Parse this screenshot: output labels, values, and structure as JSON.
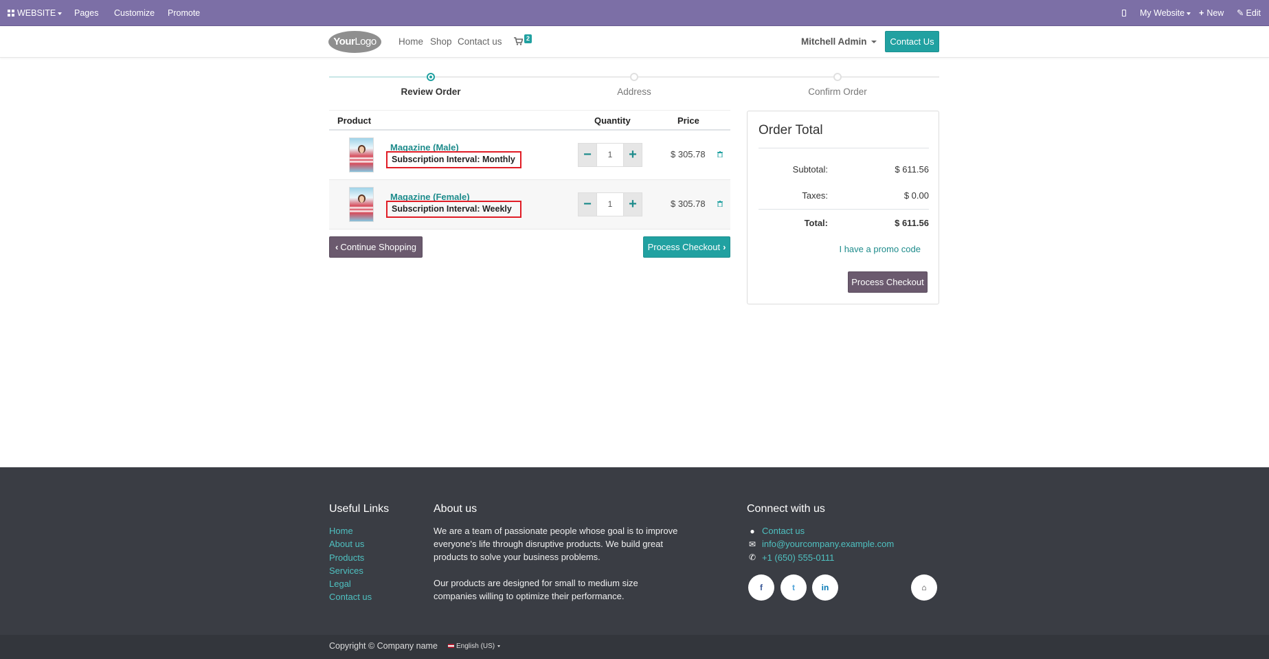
{
  "adminbar": {
    "website": "WEBSITE",
    "pages": "Pages",
    "customize": "Customize",
    "promote": "Promote",
    "my_website": "My Website",
    "new": "New",
    "edit": "Edit"
  },
  "header": {
    "logo_bold": "Your",
    "logo_light": "Logo",
    "nav": [
      "Home",
      "Shop",
      "Contact us"
    ],
    "cart_count": "2",
    "user": "Mitchell Admin",
    "contact_button": "Contact Us"
  },
  "wizard": {
    "steps": [
      "Review Order",
      "Address",
      "Confirm Order"
    ],
    "active_step": 0
  },
  "cart": {
    "headers": {
      "product": "Product",
      "quantity": "Quantity",
      "price": "Price"
    },
    "rows": [
      {
        "name": "Magazine (Male)",
        "attribute": "Subscription Interval: Monthly",
        "qty": "1",
        "price": "$ 305.78"
      },
      {
        "name": "Magazine (Female)",
        "attribute": "Subscription Interval: Weekly",
        "qty": "1",
        "price": "$ 305.78"
      }
    ],
    "continue_shopping": "Continue Shopping",
    "process_checkout": "Process Checkout"
  },
  "order_total": {
    "title": "Order Total",
    "subtotal_label": "Subtotal:",
    "subtotal": "$ 611.56",
    "taxes_label": "Taxes:",
    "taxes": "$ 0.00",
    "total_label": "Total:",
    "total": "$ 611.56",
    "promo": "I have a promo code",
    "checkout": "Process Checkout"
  },
  "footer": {
    "useful_links_title": "Useful Links",
    "useful_links": [
      "Home",
      "About us",
      "Products",
      "Services",
      "Legal",
      "Contact us"
    ],
    "about_title": "About us",
    "about_p1": "We are a team of passionate people whose goal is to improve everyone's life through disruptive products. We build great products to solve your business problems.",
    "about_p2": "Our products are designed for small to medium size companies willing to optimize their performance.",
    "connect_title": "Connect with us",
    "contact_link": "Contact us",
    "email": "info@yourcompany.example.com",
    "phone": "+1 (650) 555-0111",
    "copyright": "Copyright © Company name",
    "language": "English (US)"
  },
  "colors": {
    "admin_bar": "#7c6fa6",
    "teal": "#21a1a1",
    "dark_button": "#6b5a6e",
    "highlight_box": "#e01b24",
    "footer": "#3a3d44"
  }
}
